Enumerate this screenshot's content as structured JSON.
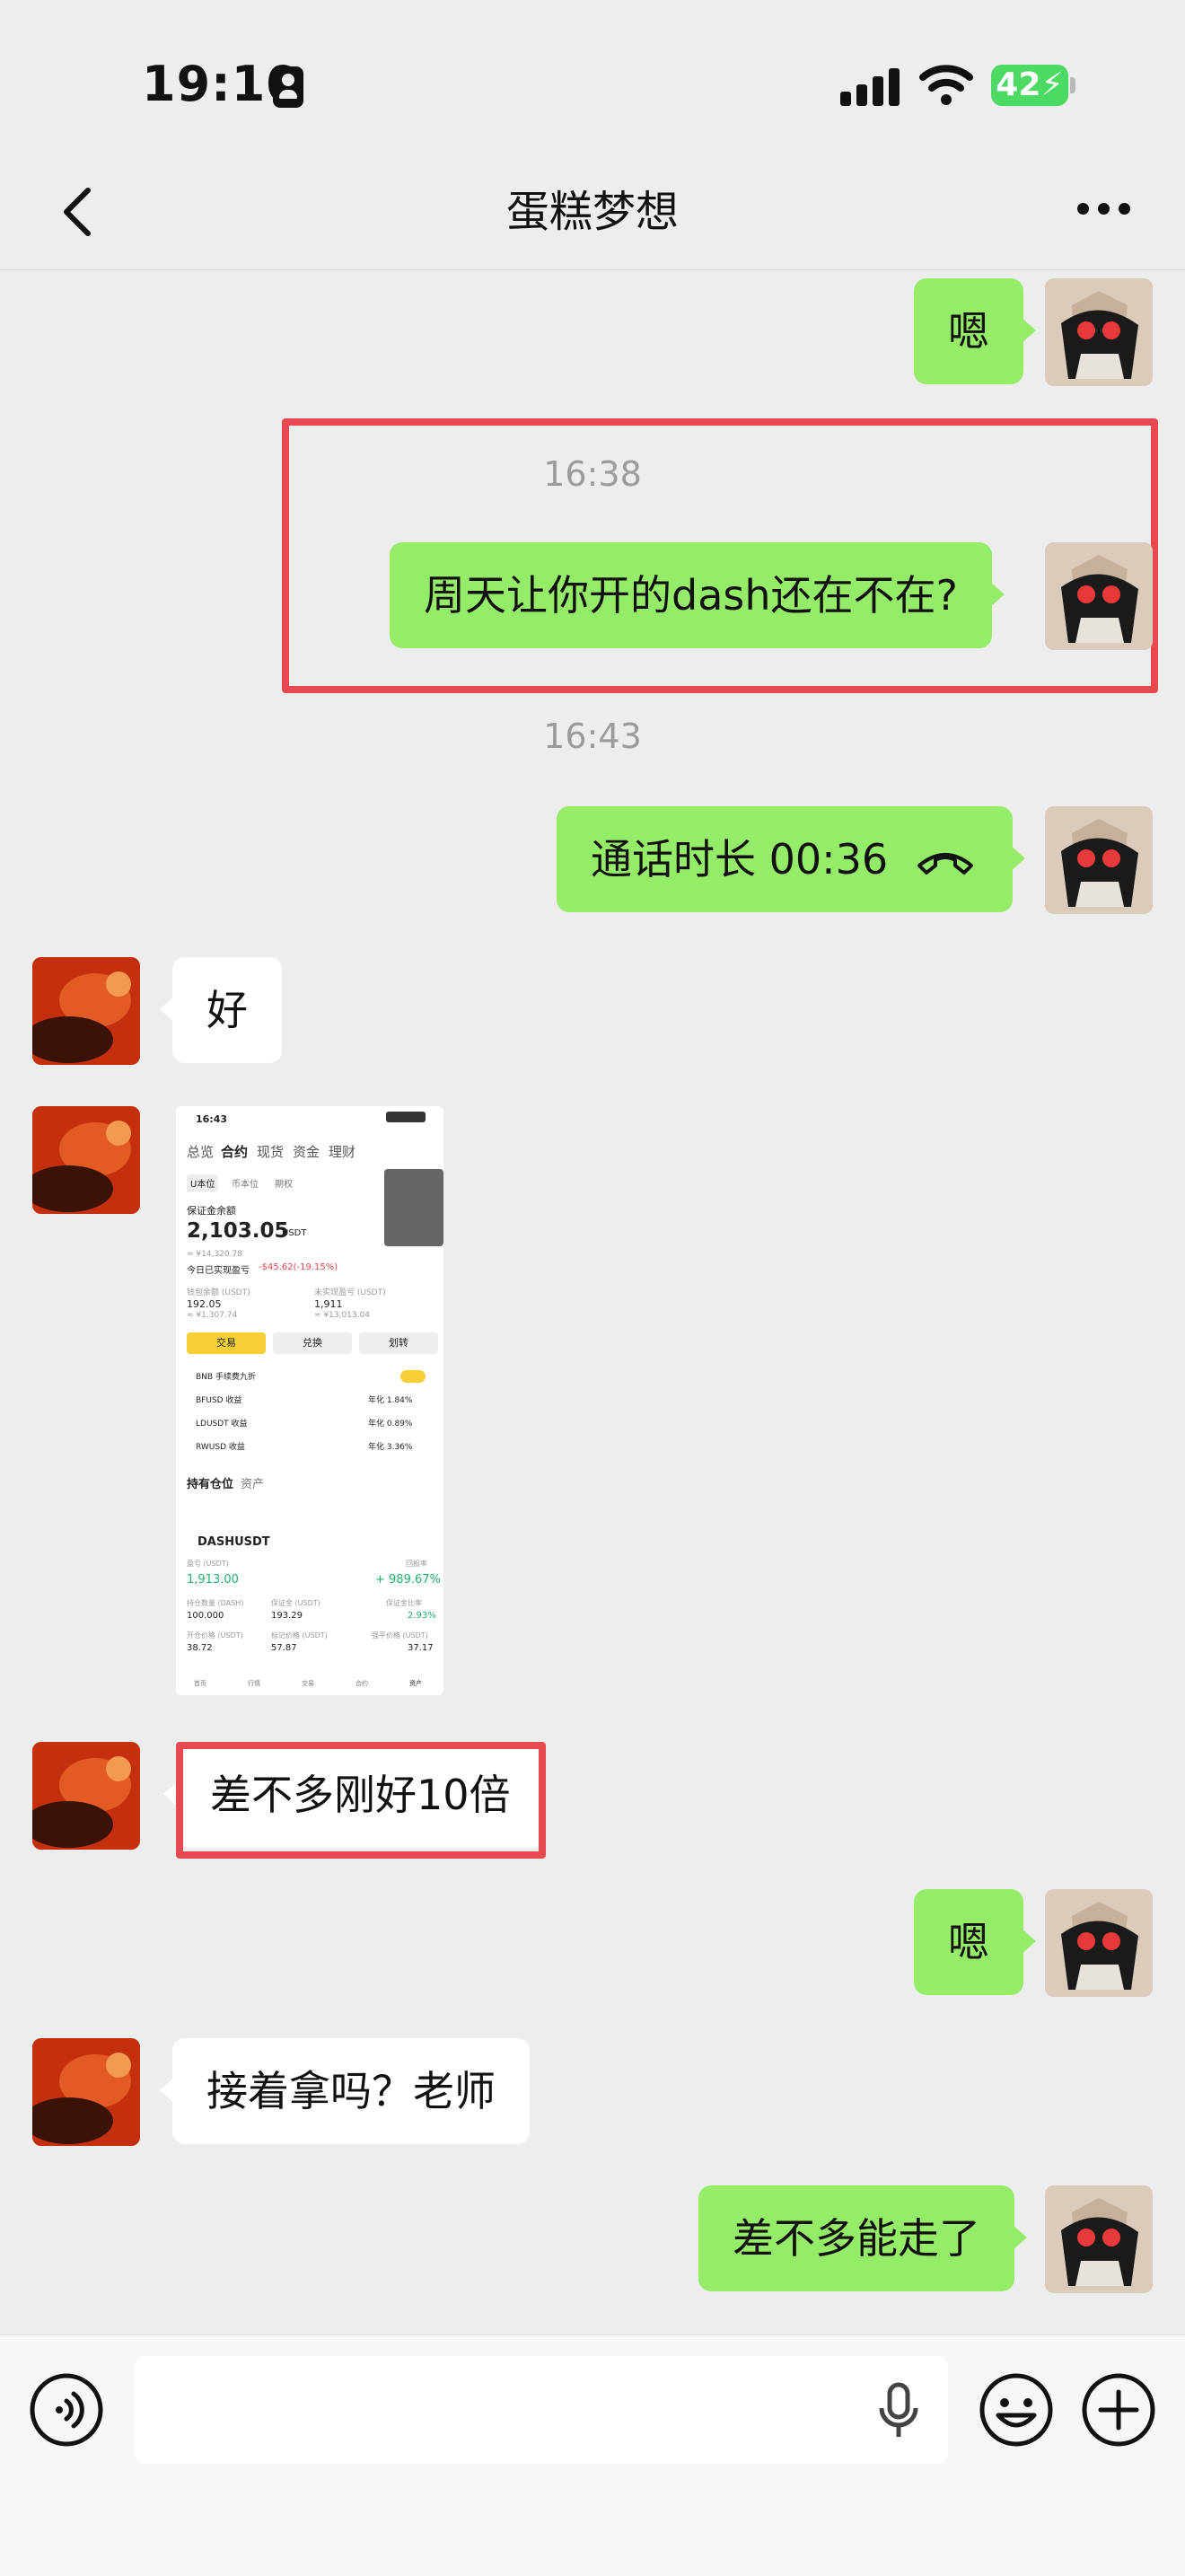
{
  "status_bar": {
    "time": "19:10",
    "battery": "42"
  },
  "header": {
    "title": "蛋糕梦想"
  },
  "messages": [
    {
      "text": "嗯"
    },
    {
      "timestamp": "16:38",
      "text": "周天让你开的dash还在不在?"
    },
    {
      "timestamp": "16:43",
      "call_text": "通话时长 00:36"
    },
    {
      "text": "好"
    },
    {
      "text": "差不多刚好10倍"
    },
    {
      "text": "嗯"
    },
    {
      "text": "接着拿吗？老师"
    },
    {
      "text": "差不多能走了"
    }
  ],
  "screenshot": {
    "time": "16:43",
    "tabs": [
      "总览",
      "合约",
      "现货",
      "资金",
      "理财"
    ],
    "subtabs": [
      "U本位",
      "币本位",
      "期权"
    ],
    "balance_label": "保证金余额",
    "balance": "2,103.05",
    "balance_unit": "USDT",
    "balance_cny": "≈ ¥14,320.78",
    "today_pnl_label": "今日已实现盈亏",
    "today_pnl": "-$45.62(-19.15%)",
    "wallet_label": "钱包余额 (USDT)",
    "wallet_value": "192.05",
    "wallet_cny": "≈ ¥1,307.74",
    "unrealized_label": "未实现盈亏 (USDT)",
    "unrealized_value": "1,911",
    "unrealized_cny": "≈ ¥13,013.04",
    "buttons": [
      "交易",
      "兑换",
      "划转"
    ],
    "rows": [
      {
        "name": "BNB 手续费九折",
        "value": ""
      },
      {
        "name": "BFUSD 收益",
        "value": "年化 1.84%"
      },
      {
        "name": "LDUSDT 收益",
        "value": "年化 0.89%"
      },
      {
        "name": "RWUSD 收益",
        "value": "年化 3.36%"
      }
    ],
    "section_tabs": [
      "持有仓位",
      "资产"
    ],
    "symbol": "DASHUSDT",
    "pnl_label": "盈亏 (USDT)",
    "pnl_value": "1,913.00",
    "roi_label": "回报率",
    "roi_value": "+ 989.67%",
    "pos_label": "持仓数量 (DASH)",
    "pos_value": "100.000",
    "margin_label": "保证金 (USDT)",
    "margin_value": "193.29",
    "ratio_label": "保证金比率",
    "ratio_value": "2.93%",
    "open_label": "开仓价格 (USDT)",
    "open_value": "38.72",
    "mark_label": "标记价格 (USDT)",
    "mark_value": "57.87",
    "liq_label": "强平价格 (USDT)",
    "liq_value": "37.17",
    "nav": [
      "首页",
      "行情",
      "交易",
      "合约",
      "资产"
    ]
  },
  "colors": {
    "bubble_green": "#95ec69",
    "highlight_red": "#e64a4f",
    "bg": "#ededed"
  },
  "icons": [
    "back-icon",
    "more-icon",
    "hangup-icon",
    "voice-icon",
    "mic-icon",
    "emoji-icon",
    "plus-icon"
  ]
}
